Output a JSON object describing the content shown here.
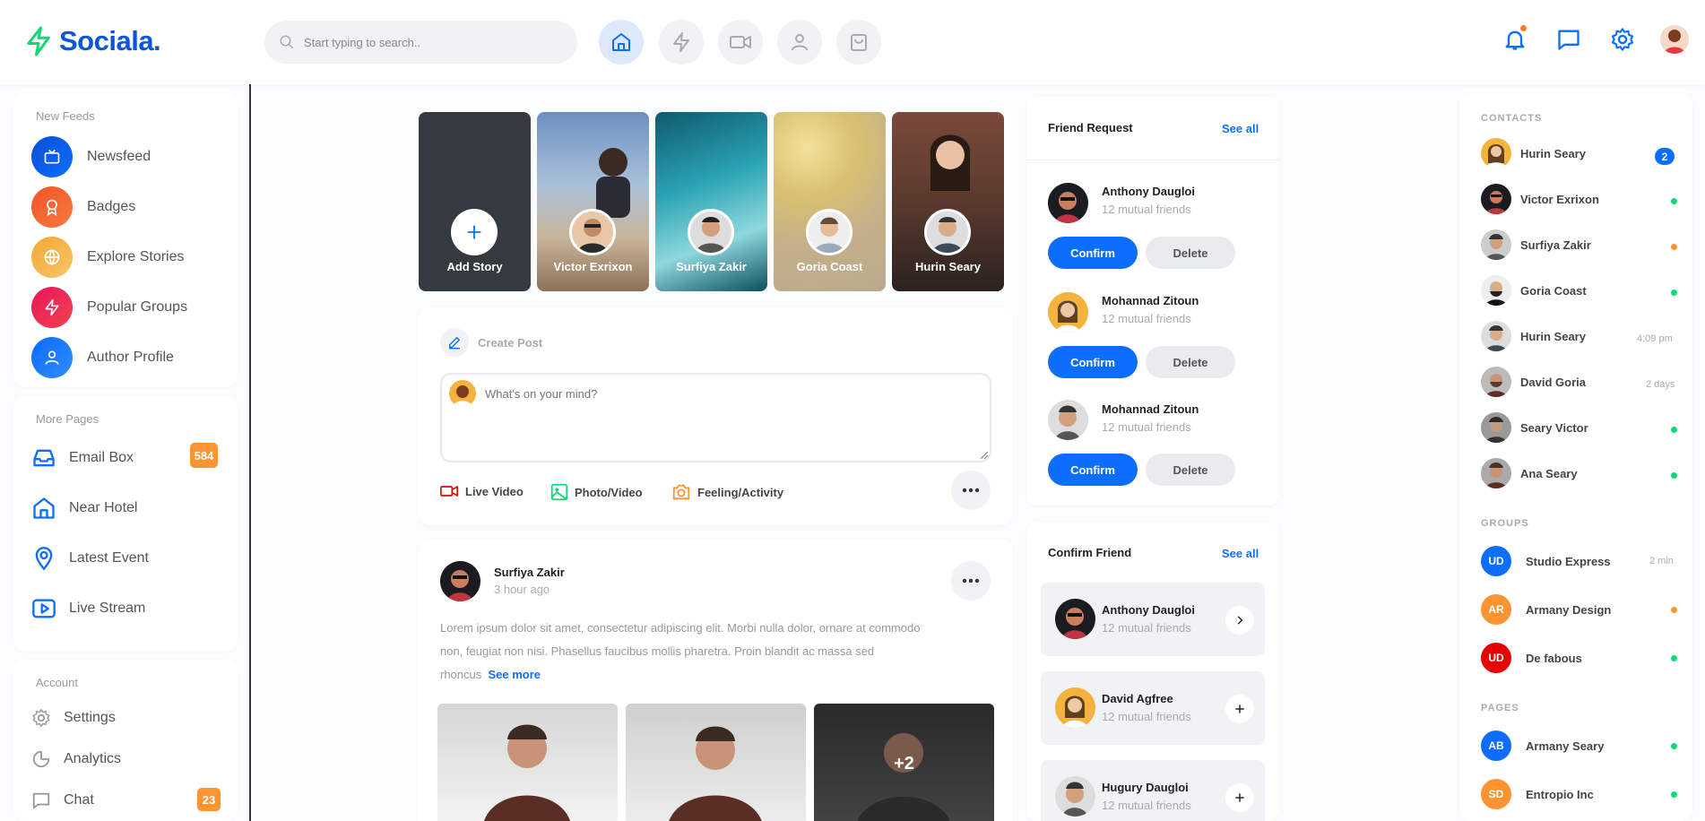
{
  "header": {
    "brand": "Sociala.",
    "search_placeholder": "Start typing to search..",
    "nav": [
      "home-icon",
      "bolt-icon",
      "video-icon",
      "user-icon",
      "shop-bag-icon"
    ]
  },
  "colors": {
    "primary": "#0d6efd",
    "brand_green": "#10d876",
    "badge_orange": "#fe9431",
    "online": "#10d876",
    "away": "#fe9431"
  },
  "left": {
    "feeds_title": "New Feeds",
    "feeds": [
      {
        "label": "Newsfeed",
        "icon": "tv-icon"
      },
      {
        "label": "Badges",
        "icon": "award-icon"
      },
      {
        "label": "Explore Stories",
        "icon": "globe-icon"
      },
      {
        "label": "Popular Groups",
        "icon": "bolt-icon"
      },
      {
        "label": "Author Profile",
        "icon": "user-icon"
      }
    ],
    "pages_title": "More Pages",
    "pages": [
      {
        "label": "Email Box",
        "badge": "584"
      },
      {
        "label": "Near Hotel",
        "badge": ""
      },
      {
        "label": "Latest Event",
        "badge": ""
      },
      {
        "label": "Live Stream",
        "badge": ""
      }
    ],
    "account_title": "Account",
    "account": [
      {
        "label": "Settings",
        "badge": ""
      },
      {
        "label": "Analytics",
        "badge": ""
      },
      {
        "label": "Chat",
        "badge": "23"
      }
    ]
  },
  "stories": {
    "add_label": "Add Story",
    "items": [
      "Victor Exrixon",
      "Surfiya Zakir",
      "Goria Coast",
      "Hurin Seary"
    ]
  },
  "create_post": {
    "title": "Create Post",
    "placeholder": "What's on your mind?",
    "actions": [
      "Live Video",
      "Photo/Video",
      "Feeling/Activity"
    ]
  },
  "post": {
    "author": "Surfiya Zakir",
    "time": "3 hour ago",
    "text": "Lorem ipsum dolor sit amet, consectetur adipiscing elit. Morbi nulla dolor, ornare at commodo non, feugiat non nisi. Phasellus faucibus mollis pharetra. Proin blandit ac massa sed rhoncus",
    "see_more": "See more",
    "more_photos": "+2"
  },
  "friend_request": {
    "title": "Friend Request",
    "see_all": "See all",
    "confirm": "Confirm",
    "delete": "Delete",
    "items": [
      {
        "name": "Anthony Daugloi",
        "mutual": "12 mutual friends"
      },
      {
        "name": "Mohannad Zitoun",
        "mutual": "12 mutual friends"
      },
      {
        "name": "Mohannad Zitoun",
        "mutual": "12 mutual friends"
      }
    ]
  },
  "confirm_friend": {
    "title": "Confirm Friend",
    "see_all": "See all",
    "items": [
      {
        "name": "Anthony Daugloi",
        "mutual": "12 mutual friends"
      },
      {
        "name": "David Agfree",
        "mutual": "12 mutual friends"
      },
      {
        "name": "Hugury Daugloi",
        "mutual": "12 mutual friends"
      }
    ]
  },
  "right": {
    "contacts_title": "CONTACTS",
    "contacts": [
      {
        "name": "Hurin Seary",
        "meta": "2",
        "kind": "badge"
      },
      {
        "name": "Victor Exrixon",
        "meta": "",
        "kind": "online"
      },
      {
        "name": "Surfiya Zakir",
        "meta": "",
        "kind": "away"
      },
      {
        "name": "Goria Coast",
        "meta": "",
        "kind": "online"
      },
      {
        "name": "Hurin Seary",
        "meta": "4:09 pm",
        "kind": "time"
      },
      {
        "name": "David Goria",
        "meta": "2 days",
        "kind": "time"
      },
      {
        "name": "Seary Victor",
        "meta": "",
        "kind": "online"
      },
      {
        "name": "Ana Seary",
        "meta": "",
        "kind": "online"
      }
    ],
    "groups_title": "GROUPS",
    "groups": [
      {
        "initials": "UD",
        "name": "Studio Express",
        "meta": "2 min",
        "color": "#0d6efd"
      },
      {
        "initials": "AR",
        "name": "Armany Design",
        "meta": "",
        "color": "#fe9431"
      },
      {
        "initials": "UD",
        "name": "De fabous",
        "meta": "",
        "color": "#e50202"
      }
    ],
    "pages_title": "PAGES",
    "pages": [
      {
        "initials": "AB",
        "name": "Armany Seary",
        "color": "#0d6efd"
      },
      {
        "initials": "SD",
        "name": "Entropio Inc",
        "color": "#fe9431"
      }
    ]
  }
}
